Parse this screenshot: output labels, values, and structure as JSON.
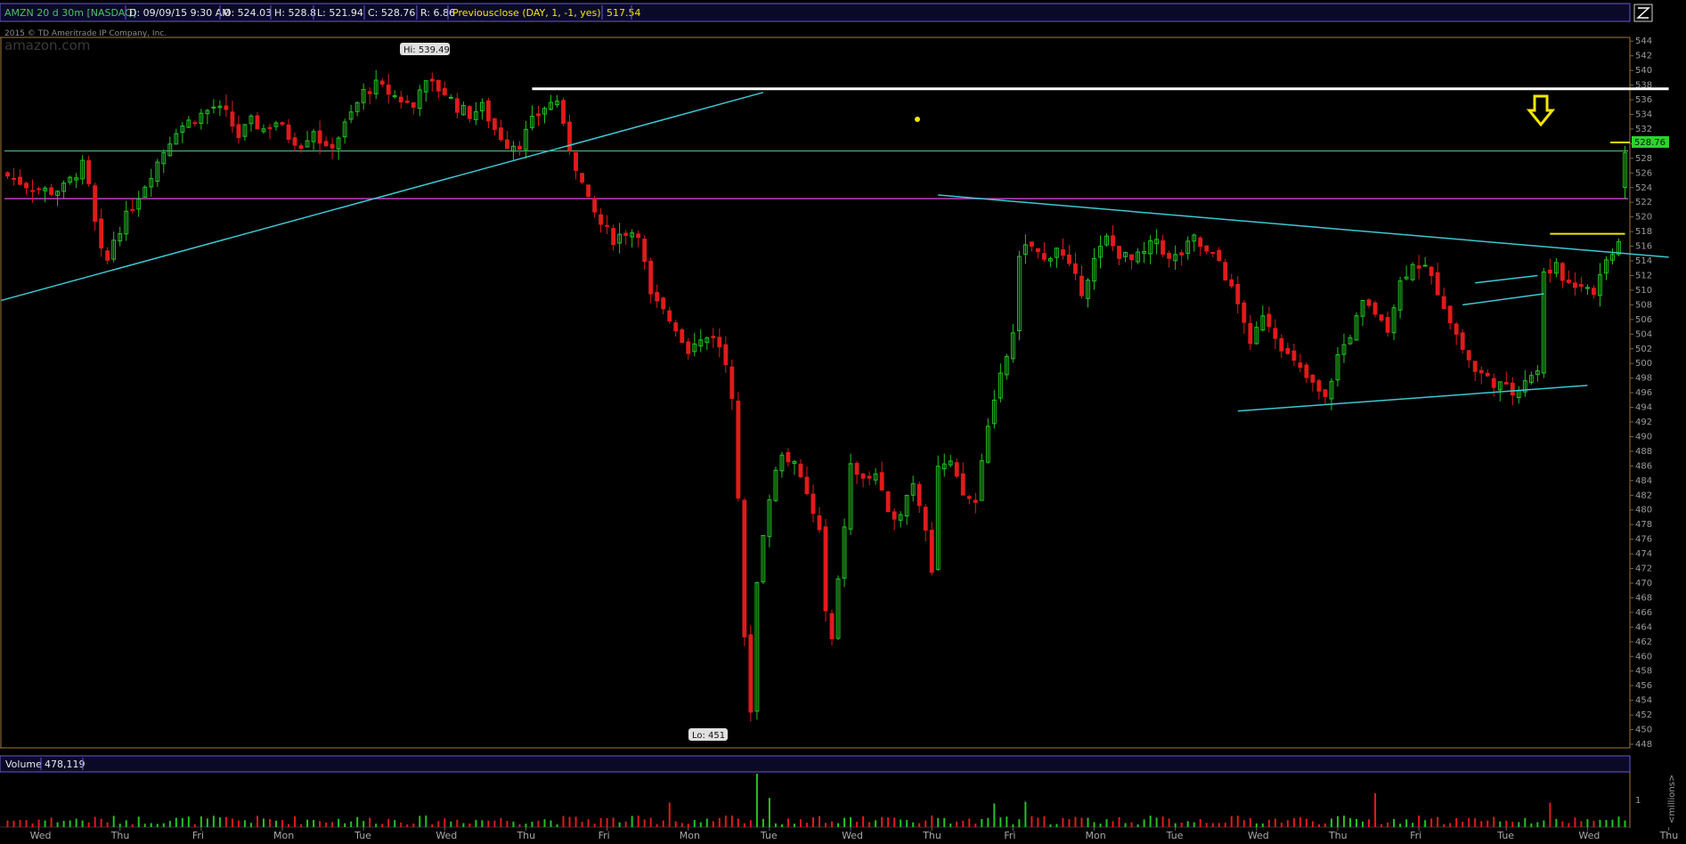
{
  "header": {
    "symbol": "AMZN 20 d 30m [NASDAQ]",
    "date": "D: 09/09/15 9:30 AM",
    "open": "O: 524.03",
    "high": "H: 528.8",
    "low": "L: 521.94",
    "close": "C: 528.76",
    "range": "R: 6.86",
    "study_label": "Previousclose (DAY, 1, -1, yes)",
    "study_value": "517.54",
    "copyright": "2015 © TD Ameritrade IP Company, Inc.",
    "watermark": "amazon.com"
  },
  "volume_panel": {
    "label": "Volume",
    "value": "478,119",
    "axis_tick": "1",
    "axis_unit": "<millions>"
  },
  "annotations": {
    "hi_label": "Hi: 539.49",
    "lo_label": "Lo: 451",
    "last_price": "528.76"
  },
  "colors": {
    "up": "#22c322",
    "down": "#e01b1b",
    "trendline": "#3cc8d2",
    "resistance": "#ffffff",
    "support_magenta": "#c040c0",
    "green_level": "#5fc88c",
    "yellow": "#f2e600",
    "header_bg": "#0a0a28",
    "header_border": "#6a5acd",
    "panel_border": "#a0783c",
    "price_tag_bg": "#2bd42b"
  },
  "chart_data": {
    "type": "candlestick",
    "symbol": "AMZN",
    "interval": "30m",
    "ylim": [
      448,
      545
    ],
    "y_ticks": [
      448,
      450,
      452,
      454,
      456,
      458,
      460,
      462,
      464,
      466,
      468,
      470,
      472,
      474,
      476,
      478,
      480,
      482,
      484,
      486,
      488,
      490,
      492,
      494,
      496,
      498,
      500,
      502,
      504,
      506,
      508,
      510,
      512,
      514,
      516,
      518,
      520,
      522,
      524,
      526,
      528,
      530,
      532,
      534,
      536,
      538,
      540,
      542,
      544
    ],
    "x_day_labels": [
      "Wed",
      "Thu",
      "Fri",
      "Mon",
      "Tue",
      "Wed",
      "Thu",
      "Fri",
      "Mon",
      "Tue",
      "Wed",
      "Thu",
      "Fri",
      "Mon",
      "Tue",
      "Wed",
      "Thu",
      "Fri",
      "Tue",
      "Wed",
      "Thu"
    ],
    "x_day_index": [
      5,
      18,
      31,
      44,
      57,
      70,
      83,
      96,
      109,
      122,
      135,
      148,
      161,
      174,
      187,
      200,
      213,
      226,
      240,
      253,
      266
    ],
    "candle_count": 260,
    "anchors": [
      [
        0,
        526
      ],
      [
        5,
        524
      ],
      [
        8,
        523.5
      ],
      [
        10,
        524
      ],
      [
        13,
        527
      ],
      [
        14,
        524
      ],
      [
        15,
        519
      ],
      [
        16,
        515
      ],
      [
        17,
        514
      ],
      [
        18,
        517
      ],
      [
        20,
        520
      ],
      [
        22,
        523
      ],
      [
        24,
        526
      ],
      [
        26,
        529
      ],
      [
        28,
        532
      ],
      [
        30,
        533
      ],
      [
        32,
        534
      ],
      [
        34,
        535
      ],
      [
        36,
        534
      ],
      [
        38,
        531
      ],
      [
        40,
        533
      ],
      [
        42,
        532
      ],
      [
        44,
        533
      ],
      [
        46,
        531
      ],
      [
        48,
        530
      ],
      [
        50,
        532
      ],
      [
        52,
        529
      ],
      [
        54,
        531
      ],
      [
        56,
        534
      ],
      [
        58,
        537
      ],
      [
        60,
        538
      ],
      [
        62,
        537
      ],
      [
        64,
        536
      ],
      [
        66,
        535
      ],
      [
        67,
        538
      ],
      [
        69,
        538
      ],
      [
        71,
        537
      ],
      [
        73,
        535
      ],
      [
        75,
        534
      ],
      [
        77,
        535
      ],
      [
        79,
        532
      ],
      [
        81,
        530
      ],
      [
        83,
        530
      ],
      [
        85,
        533
      ],
      [
        87,
        535
      ],
      [
        89,
        536
      ],
      [
        90,
        532
      ],
      [
        92,
        527
      ],
      [
        94,
        522
      ],
      [
        96,
        519
      ],
      [
        98,
        517
      ],
      [
        100,
        518
      ],
      [
        102,
        518
      ],
      [
        104,
        509
      ],
      [
        106,
        507
      ],
      [
        108,
        505
      ],
      [
        110,
        502
      ],
      [
        112,
        503
      ],
      [
        114,
        504
      ],
      [
        116,
        500
      ],
      [
        117,
        496
      ],
      [
        118,
        482
      ],
      [
        119,
        462
      ],
      [
        120,
        453
      ],
      [
        121,
        470
      ],
      [
        123,
        482
      ],
      [
        125,
        488
      ],
      [
        127,
        486
      ],
      [
        129,
        482
      ],
      [
        131,
        477
      ],
      [
        132,
        466
      ],
      [
        133,
        462
      ],
      [
        134,
        470
      ],
      [
        136,
        486
      ],
      [
        138,
        484
      ],
      [
        140,
        485
      ],
      [
        142,
        479
      ],
      [
        144,
        480
      ],
      [
        146,
        484
      ],
      [
        148,
        478
      ],
      [
        149,
        472
      ],
      [
        150,
        486
      ],
      [
        152,
        486
      ],
      [
        154,
        482
      ],
      [
        156,
        481
      ],
      [
        158,
        492
      ],
      [
        160,
        498
      ],
      [
        162,
        504
      ],
      [
        163,
        515
      ],
      [
        165,
        516
      ],
      [
        167,
        514
      ],
      [
        169,
        516
      ],
      [
        171,
        513
      ],
      [
        173,
        510
      ],
      [
        175,
        514
      ],
      [
        177,
        517
      ],
      [
        179,
        515
      ],
      [
        181,
        514
      ],
      [
        183,
        515
      ],
      [
        185,
        517
      ],
      [
        187,
        514
      ],
      [
        189,
        515
      ],
      [
        191,
        517
      ],
      [
        193,
        515
      ],
      [
        195,
        514
      ],
      [
        197,
        510
      ],
      [
        199,
        506
      ],
      [
        200,
        502
      ],
      [
        202,
        507
      ],
      [
        204,
        504
      ],
      [
        206,
        501
      ],
      [
        208,
        499
      ],
      [
        210,
        497
      ],
      [
        212,
        495
      ],
      [
        214,
        501
      ],
      [
        216,
        504
      ],
      [
        218,
        508
      ],
      [
        220,
        507
      ],
      [
        222,
        505
      ],
      [
        224,
        511
      ],
      [
        226,
        514
      ],
      [
        228,
        513
      ],
      [
        230,
        510
      ],
      [
        232,
        506
      ],
      [
        234,
        502
      ],
      [
        236,
        499
      ],
      [
        238,
        498
      ],
      [
        240,
        497
      ],
      [
        242,
        496
      ],
      [
        244,
        498
      ],
      [
        246,
        499
      ],
      [
        247,
        512
      ],
      [
        249,
        513
      ],
      [
        251,
        511
      ],
      [
        253,
        511
      ],
      [
        255,
        510
      ],
      [
        257,
        514
      ],
      [
        259,
        517
      ],
      [
        260,
        523
      ],
      [
        261,
        528.76
      ]
    ]
  }
}
